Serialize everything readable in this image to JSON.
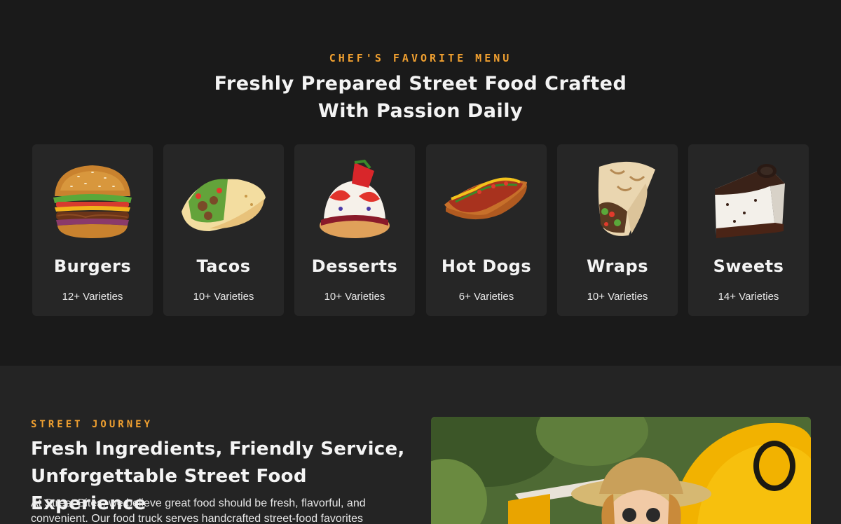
{
  "menu": {
    "eyebrow": "CHEF'S FAVORITE MENU",
    "title_line1": "Freshly Prepared Street Food Crafted",
    "title_line2": "With Passion Daily",
    "items": [
      {
        "name": "Burgers",
        "count": "12+ Varieties",
        "icon": "burger-image"
      },
      {
        "name": "Tacos",
        "count": "10+ Varieties",
        "icon": "taco-image"
      },
      {
        "name": "Desserts",
        "count": "10+ Varieties",
        "icon": "dessert-image"
      },
      {
        "name": "Hot Dogs",
        "count": "6+ Varieties",
        "icon": "hotdog-image"
      },
      {
        "name": "Wraps",
        "count": "10+ Varieties",
        "icon": "wrap-image"
      },
      {
        "name": "Sweets",
        "count": "14+ Varieties",
        "icon": "cake-image"
      }
    ]
  },
  "journey": {
    "eyebrow": "STREET JOURNEY",
    "title_line1": "Fresh Ingredients, Friendly Service,",
    "title_line2": "Unforgettable Street Food Experience",
    "body": "At Street Bites, we believe great food should be fresh, flavorful, and convenient. Our food truck serves handcrafted street-food favorites",
    "photo": "woman-with-food-truck-photo"
  },
  "colors": {
    "accent": "#f0a030",
    "background": "#1a1a1a",
    "card": "#262626",
    "section2": "#242424"
  }
}
